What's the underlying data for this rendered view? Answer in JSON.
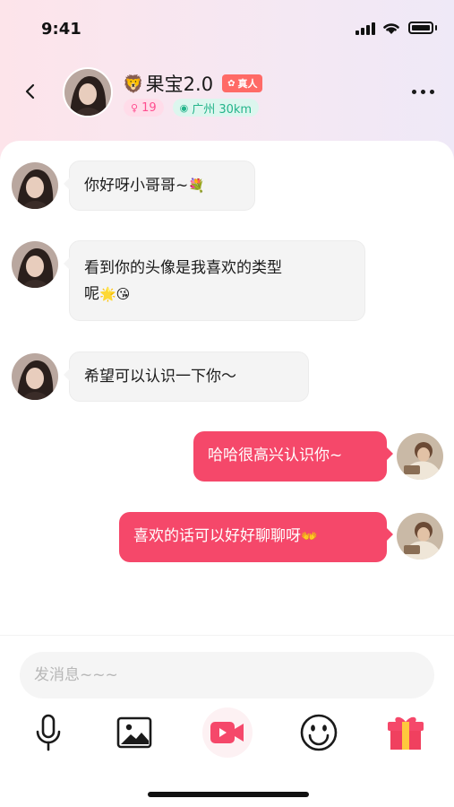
{
  "status_bar": {
    "time": "9:41"
  },
  "header": {
    "name": "果宝2.0",
    "name_emoji": "🦁",
    "verified_label": "真人",
    "verified_icon": "✿",
    "age_icon": "♀",
    "age": "19",
    "location_icon": "◉",
    "location": "广州 30km"
  },
  "messages": [
    {
      "side": "in",
      "text": "你好呀小哥哥~",
      "emoji": "💐"
    },
    {
      "side": "in",
      "text_line1": "看到你的头像是我喜欢的类型",
      "text_line2": "呢",
      "emoji": "🌟😘"
    },
    {
      "side": "in",
      "text": "希望可以认识一下你～"
    },
    {
      "side": "out",
      "text": "哈哈很高兴认识你~"
    },
    {
      "side": "out",
      "text": "喜欢的话可以好好聊聊呀",
      "emoji": "👐"
    }
  ],
  "input": {
    "placeholder": "发消息~~~"
  },
  "toolbar": {
    "items": [
      "mic-icon",
      "image-icon",
      "video-call-icon",
      "emoji-icon",
      "gift-icon"
    ]
  },
  "colors": {
    "accent": "#f5486a",
    "verified": "#ff6a66",
    "age_tag_text": "#ff4d8f",
    "location_tag_text": "#23b48a"
  }
}
